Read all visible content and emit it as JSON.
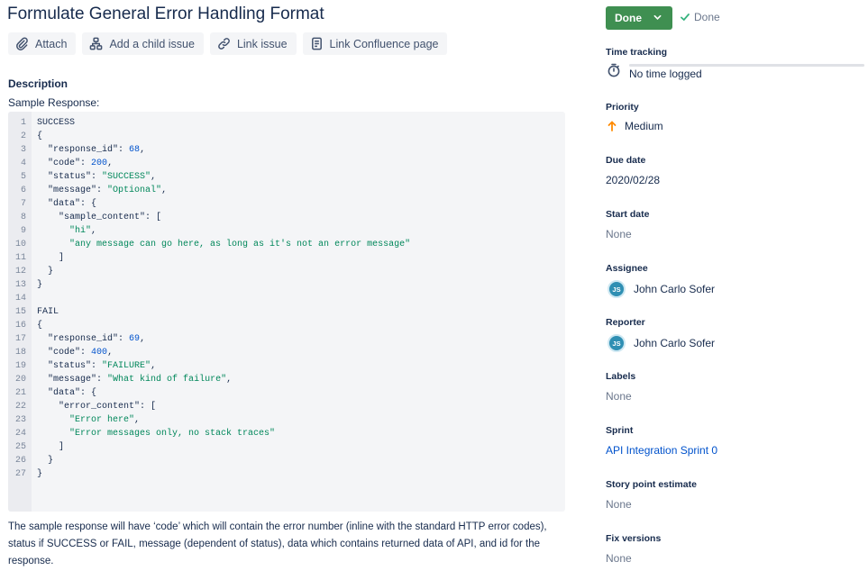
{
  "issue": {
    "title": "Formulate General Error Handling Format",
    "actions": [
      {
        "label": "Attach",
        "icon": "paperclip-icon"
      },
      {
        "label": "Add a child issue",
        "icon": "hierarchy-icon"
      },
      {
        "label": "Link issue",
        "icon": "link-icon"
      },
      {
        "label": "Link Confluence page",
        "icon": "document-icon"
      }
    ]
  },
  "description": {
    "heading": "Description",
    "label": "Sample Response:",
    "code_lines": [
      "SUCCESS",
      "{",
      "  \"response_id\": 68,",
      "  \"code\": 200,",
      "  \"status\": \"SUCCESS\",",
      "  \"message\": \"Optional\",",
      "  \"data\": {",
      "    \"sample_content\": [",
      "      \"hi\",",
      "      \"any message can go here, as long as it's not an error message\"",
      "    ]",
      "  }",
      "}",
      "",
      "FAIL",
      "{",
      "  \"response_id\": 69,",
      "  \"code\": 400,",
      "  \"status\": \"FAILURE\",",
      "  \"message\": \"What kind of failure\",",
      "  \"data\": {",
      "    \"error_content\": [",
      "      \"Error here\",",
      "      \"Error messages only, no stack traces\"",
      "    ]",
      "  }",
      "}",
      ""
    ],
    "line_count": 27,
    "summary": "The sample response will have ‘code’ which will contain the error number (inline with the standard HTTP error codes), status if SUCCESS or FAIL, message (dependent of status), data which contains returned data of API, and id for the response."
  },
  "sidebar": {
    "status_button": "Done",
    "resolution": "Done",
    "time_tracking": {
      "label": "Time tracking",
      "value": "No time logged"
    },
    "priority": {
      "label": "Priority",
      "value": "Medium"
    },
    "due_date": {
      "label": "Due date",
      "value": "2020/02/28"
    },
    "start_date": {
      "label": "Start date",
      "value": "None"
    },
    "assignee": {
      "label": "Assignee",
      "initials": "JS",
      "value": "John Carlo Sofer"
    },
    "reporter": {
      "label": "Reporter",
      "initials": "JS",
      "value": "John Carlo Sofer"
    },
    "labels": {
      "label": "Labels",
      "value": "None"
    },
    "sprint": {
      "label": "Sprint",
      "value": "API Integration Sprint 0"
    },
    "story_points": {
      "label": "Story point estimate",
      "value": "None"
    },
    "fix_versions": {
      "label": "Fix versions",
      "value": "None"
    }
  },
  "colors": {
    "status_green": "#3f8f51",
    "priority_orange": "#ff8b00",
    "link_blue": "#0052cc",
    "code_string": "#00875a",
    "code_number": "#0052cc"
  }
}
